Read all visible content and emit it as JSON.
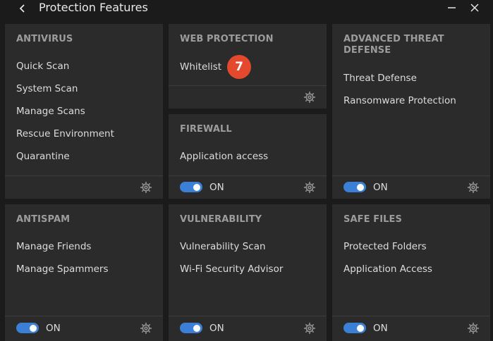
{
  "window": {
    "title": "Protection Features"
  },
  "cards": {
    "antivirus": {
      "title": "ANTIVIRUS",
      "items": [
        "Quick Scan",
        "System Scan",
        "Manage Scans",
        "Rescue Environment",
        "Quarantine"
      ]
    },
    "web_protection": {
      "title": "WEB PROTECTION",
      "items": [
        "Whitelist"
      ],
      "badge": "7"
    },
    "advanced_threat_defense": {
      "title": "ADVANCED THREAT DEFENSE",
      "items": [
        "Threat Defense",
        "Ransomware Protection"
      ],
      "toggle_label": "ON",
      "toggle_on": true
    },
    "firewall": {
      "title": "FIREWALL",
      "items": [
        "Application access"
      ],
      "toggle_label": "ON",
      "toggle_on": true
    },
    "antispam": {
      "title": "ANTISPAM",
      "items": [
        "Manage Friends",
        "Manage Spammers"
      ],
      "toggle_label": "ON",
      "toggle_on": true
    },
    "vulnerability": {
      "title": "VULNERABILITY",
      "items": [
        "Vulnerability Scan",
        "Wi-Fi Security Advisor"
      ],
      "toggle_label": "ON",
      "toggle_on": true
    },
    "safe_files": {
      "title": "SAFE FILES",
      "items": [
        "Protected Folders",
        "Application Access"
      ],
      "toggle_label": "ON",
      "toggle_on": true
    }
  },
  "icons": {
    "back": "chevron-left-icon",
    "minimize": "minimize-icon",
    "close": "close-icon",
    "settings": "gear-icon"
  },
  "colors": {
    "background": "#1b1b1b",
    "card": "#2b2b2b",
    "title_text": "#9c9c9c",
    "item_text": "#dcdcdc",
    "toggle_on": "#3b80d6",
    "badge": "#e4492d"
  }
}
